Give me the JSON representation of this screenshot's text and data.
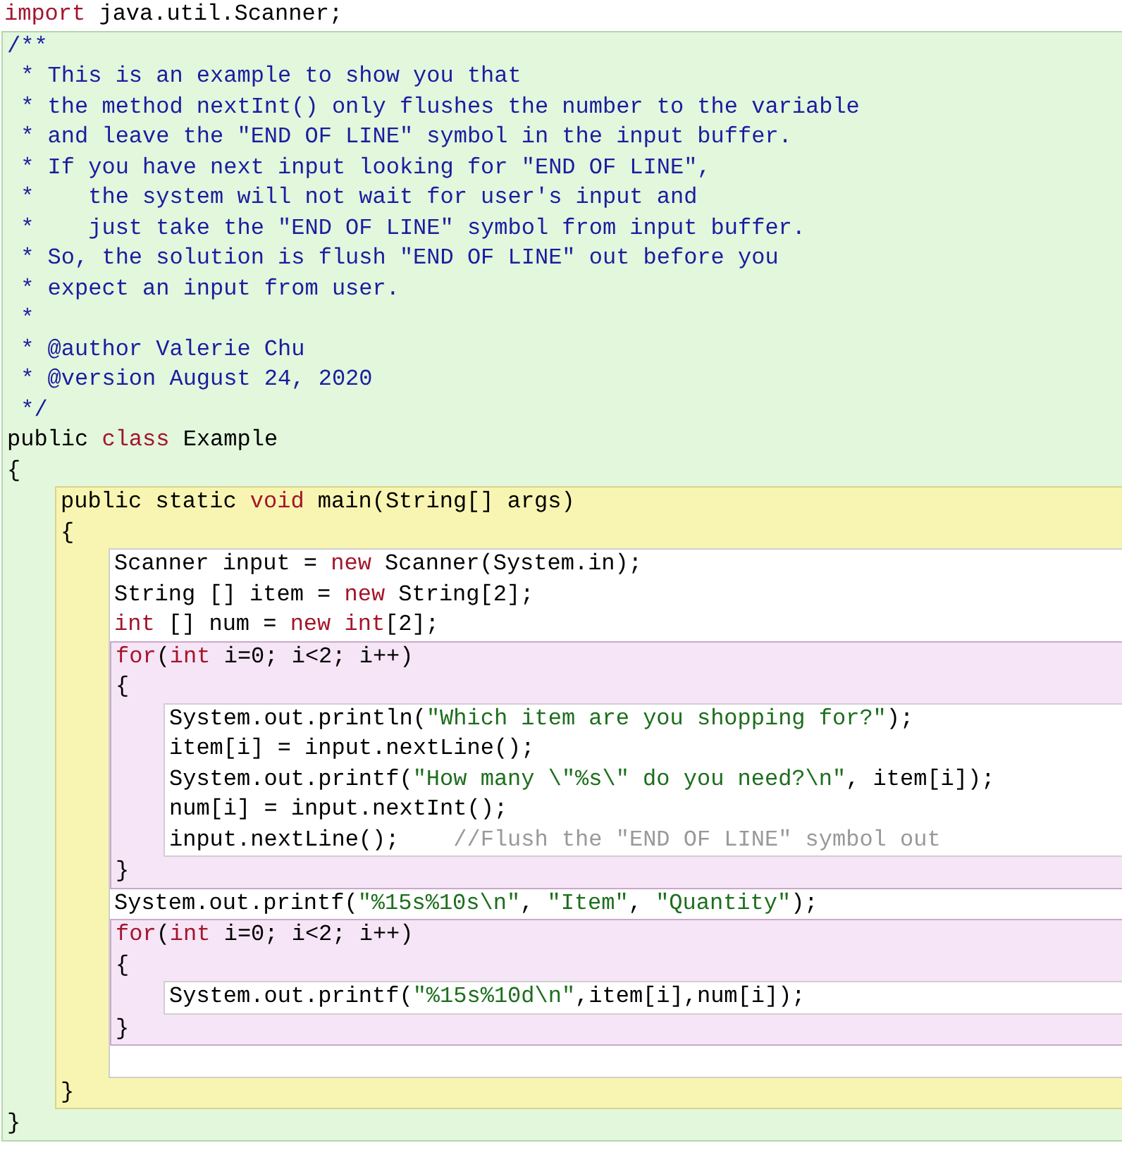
{
  "editor": {
    "items": [
      {
        "kind": "line",
        "tokens": [
          {
            "kind": "keyword",
            "text": "import"
          },
          {
            "kind": "plain",
            "text": " java.util.Scanner;"
          }
        ]
      },
      {
        "kind": "class",
        "items": [
          {
            "kind": "line",
            "tokens": [
              {
                "kind": "javadoc",
                "text": "/**"
              }
            ]
          },
          {
            "kind": "line",
            "tokens": [
              {
                "kind": "javadoc",
                "text": " * This is an example to show you that"
              }
            ]
          },
          {
            "kind": "line",
            "tokens": [
              {
                "kind": "javadoc",
                "text": " * the method nextInt() only flushes the number to the variable"
              }
            ]
          },
          {
            "kind": "line",
            "tokens": [
              {
                "kind": "javadoc",
                "text": " * and leave the \"END OF LINE\" symbol in the input buffer."
              }
            ]
          },
          {
            "kind": "line",
            "tokens": [
              {
                "kind": "javadoc",
                "text": " * If you have next input looking for \"END OF LINE\","
              }
            ]
          },
          {
            "kind": "line",
            "tokens": [
              {
                "kind": "javadoc",
                "text": " *    the system will not wait for user's input and"
              }
            ]
          },
          {
            "kind": "line",
            "tokens": [
              {
                "kind": "javadoc",
                "text": " *    just take the \"END OF LINE\" symbol from input buffer."
              }
            ]
          },
          {
            "kind": "line",
            "tokens": [
              {
                "kind": "javadoc",
                "text": " * So, the solution is flush \"END OF LINE\" out before you"
              }
            ]
          },
          {
            "kind": "line",
            "tokens": [
              {
                "kind": "javadoc",
                "text": " * expect an input from user."
              }
            ]
          },
          {
            "kind": "line",
            "tokens": [
              {
                "kind": "javadoc",
                "text": " *"
              }
            ]
          },
          {
            "kind": "line",
            "tokens": [
              {
                "kind": "javadoc",
                "text": " * @author Valerie Chu"
              }
            ]
          },
          {
            "kind": "line",
            "tokens": [
              {
                "kind": "javadoc",
                "text": " * @version August 24, 2020"
              }
            ]
          },
          {
            "kind": "line",
            "tokens": [
              {
                "kind": "javadoc",
                "text": " */"
              }
            ]
          },
          {
            "kind": "line",
            "tokens": [
              {
                "kind": "plain",
                "text": "public "
              },
              {
                "kind": "keyword",
                "text": "class"
              },
              {
                "kind": "plain",
                "text": " Example"
              }
            ]
          },
          {
            "kind": "line",
            "tokens": [
              {
                "kind": "plain",
                "text": "{"
              }
            ]
          },
          {
            "kind": "method",
            "items": [
              {
                "kind": "line",
                "tokens": [
                  {
                    "kind": "plain",
                    "text": "public static "
                  },
                  {
                    "kind": "keyword",
                    "text": "void"
                  },
                  {
                    "kind": "plain",
                    "text": " main(String[] args)"
                  }
                ]
              },
              {
                "kind": "line",
                "tokens": [
                  {
                    "kind": "plain",
                    "text": "{"
                  }
                ]
              },
              {
                "kind": "body",
                "items": [
                  {
                    "kind": "line",
                    "tokens": [
                      {
                        "kind": "plain",
                        "text": "Scanner input = "
                      },
                      {
                        "kind": "keyword",
                        "text": "new"
                      },
                      {
                        "kind": "plain",
                        "text": " Scanner(System.in);"
                      }
                    ]
                  },
                  {
                    "kind": "line",
                    "tokens": [
                      {
                        "kind": "plain",
                        "text": "String [] item = "
                      },
                      {
                        "kind": "keyword",
                        "text": "new"
                      },
                      {
                        "kind": "plain",
                        "text": " String[2];"
                      }
                    ]
                  },
                  {
                    "kind": "line",
                    "tokens": [
                      {
                        "kind": "keyword",
                        "text": "int"
                      },
                      {
                        "kind": "plain",
                        "text": " [] num = "
                      },
                      {
                        "kind": "keyword",
                        "text": "new int"
                      },
                      {
                        "kind": "plain",
                        "text": "[2];"
                      }
                    ]
                  },
                  {
                    "kind": "loop",
                    "items": [
                      {
                        "kind": "line",
                        "tokens": [
                          {
                            "kind": "keyword",
                            "text": "for"
                          },
                          {
                            "kind": "plain",
                            "text": "("
                          },
                          {
                            "kind": "keyword",
                            "text": "int"
                          },
                          {
                            "kind": "plain",
                            "text": " i=0; i<2; i++)"
                          }
                        ]
                      },
                      {
                        "kind": "line",
                        "tokens": [
                          {
                            "kind": "plain",
                            "text": "{"
                          }
                        ]
                      },
                      {
                        "kind": "body",
                        "items": [
                          {
                            "kind": "line",
                            "tokens": [
                              {
                                "kind": "plain",
                                "text": "System.out.println("
                              },
                              {
                                "kind": "string",
                                "text": "\"Which item are you shopping for?\""
                              },
                              {
                                "kind": "plain",
                                "text": ");"
                              }
                            ]
                          },
                          {
                            "kind": "line",
                            "tokens": [
                              {
                                "kind": "plain",
                                "text": "item[i] = input.nextLine();"
                              }
                            ]
                          },
                          {
                            "kind": "line",
                            "tokens": [
                              {
                                "kind": "plain",
                                "text": "System.out.printf("
                              },
                              {
                                "kind": "string",
                                "text": "\"How many \\\"%s\\\" do you need?\\n\""
                              },
                              {
                                "kind": "plain",
                                "text": ", item[i]);"
                              }
                            ]
                          },
                          {
                            "kind": "line",
                            "tokens": [
                              {
                                "kind": "plain",
                                "text": "num[i] = input.nextInt();"
                              }
                            ]
                          },
                          {
                            "kind": "line",
                            "tokens": [
                              {
                                "kind": "plain",
                                "text": "input.nextLine();    "
                              },
                              {
                                "kind": "comment",
                                "text": "//Flush the \"END OF LINE\" symbol out"
                              }
                            ]
                          }
                        ]
                      },
                      {
                        "kind": "line",
                        "tokens": [
                          {
                            "kind": "plain",
                            "text": "}"
                          }
                        ]
                      }
                    ]
                  },
                  {
                    "kind": "line",
                    "tokens": [
                      {
                        "kind": "plain",
                        "text": "System.out.printf("
                      },
                      {
                        "kind": "string",
                        "text": "\"%15s%10s\\n\""
                      },
                      {
                        "kind": "plain",
                        "text": ", "
                      },
                      {
                        "kind": "string",
                        "text": "\"Item\""
                      },
                      {
                        "kind": "plain",
                        "text": ", "
                      },
                      {
                        "kind": "string",
                        "text": "\"Quantity\""
                      },
                      {
                        "kind": "plain",
                        "text": ");"
                      }
                    ]
                  },
                  {
                    "kind": "loop",
                    "items": [
                      {
                        "kind": "line",
                        "tokens": [
                          {
                            "kind": "keyword",
                            "text": "for"
                          },
                          {
                            "kind": "plain",
                            "text": "("
                          },
                          {
                            "kind": "keyword",
                            "text": "int"
                          },
                          {
                            "kind": "plain",
                            "text": " i=0; i<2; i++)"
                          }
                        ]
                      },
                      {
                        "kind": "line",
                        "tokens": [
                          {
                            "kind": "plain",
                            "text": "{"
                          }
                        ]
                      },
                      {
                        "kind": "body",
                        "items": [
                          {
                            "kind": "line",
                            "tokens": [
                              {
                                "kind": "plain",
                                "text": "System.out.printf("
                              },
                              {
                                "kind": "string",
                                "text": "\"%15s%10d\\n\""
                              },
                              {
                                "kind": "plain",
                                "text": ",item[i],num[i]);"
                              }
                            ]
                          }
                        ]
                      },
                      {
                        "kind": "line",
                        "tokens": [
                          {
                            "kind": "plain",
                            "text": "}"
                          }
                        ]
                      }
                    ]
                  },
                  {
                    "kind": "blank"
                  }
                ]
              },
              {
                "kind": "line",
                "tokens": [
                  {
                    "kind": "plain",
                    "text": "}"
                  }
                ]
              }
            ]
          },
          {
            "kind": "line",
            "tokens": [
              {
                "kind": "plain",
                "text": "}"
              }
            ]
          }
        ]
      }
    ]
  }
}
